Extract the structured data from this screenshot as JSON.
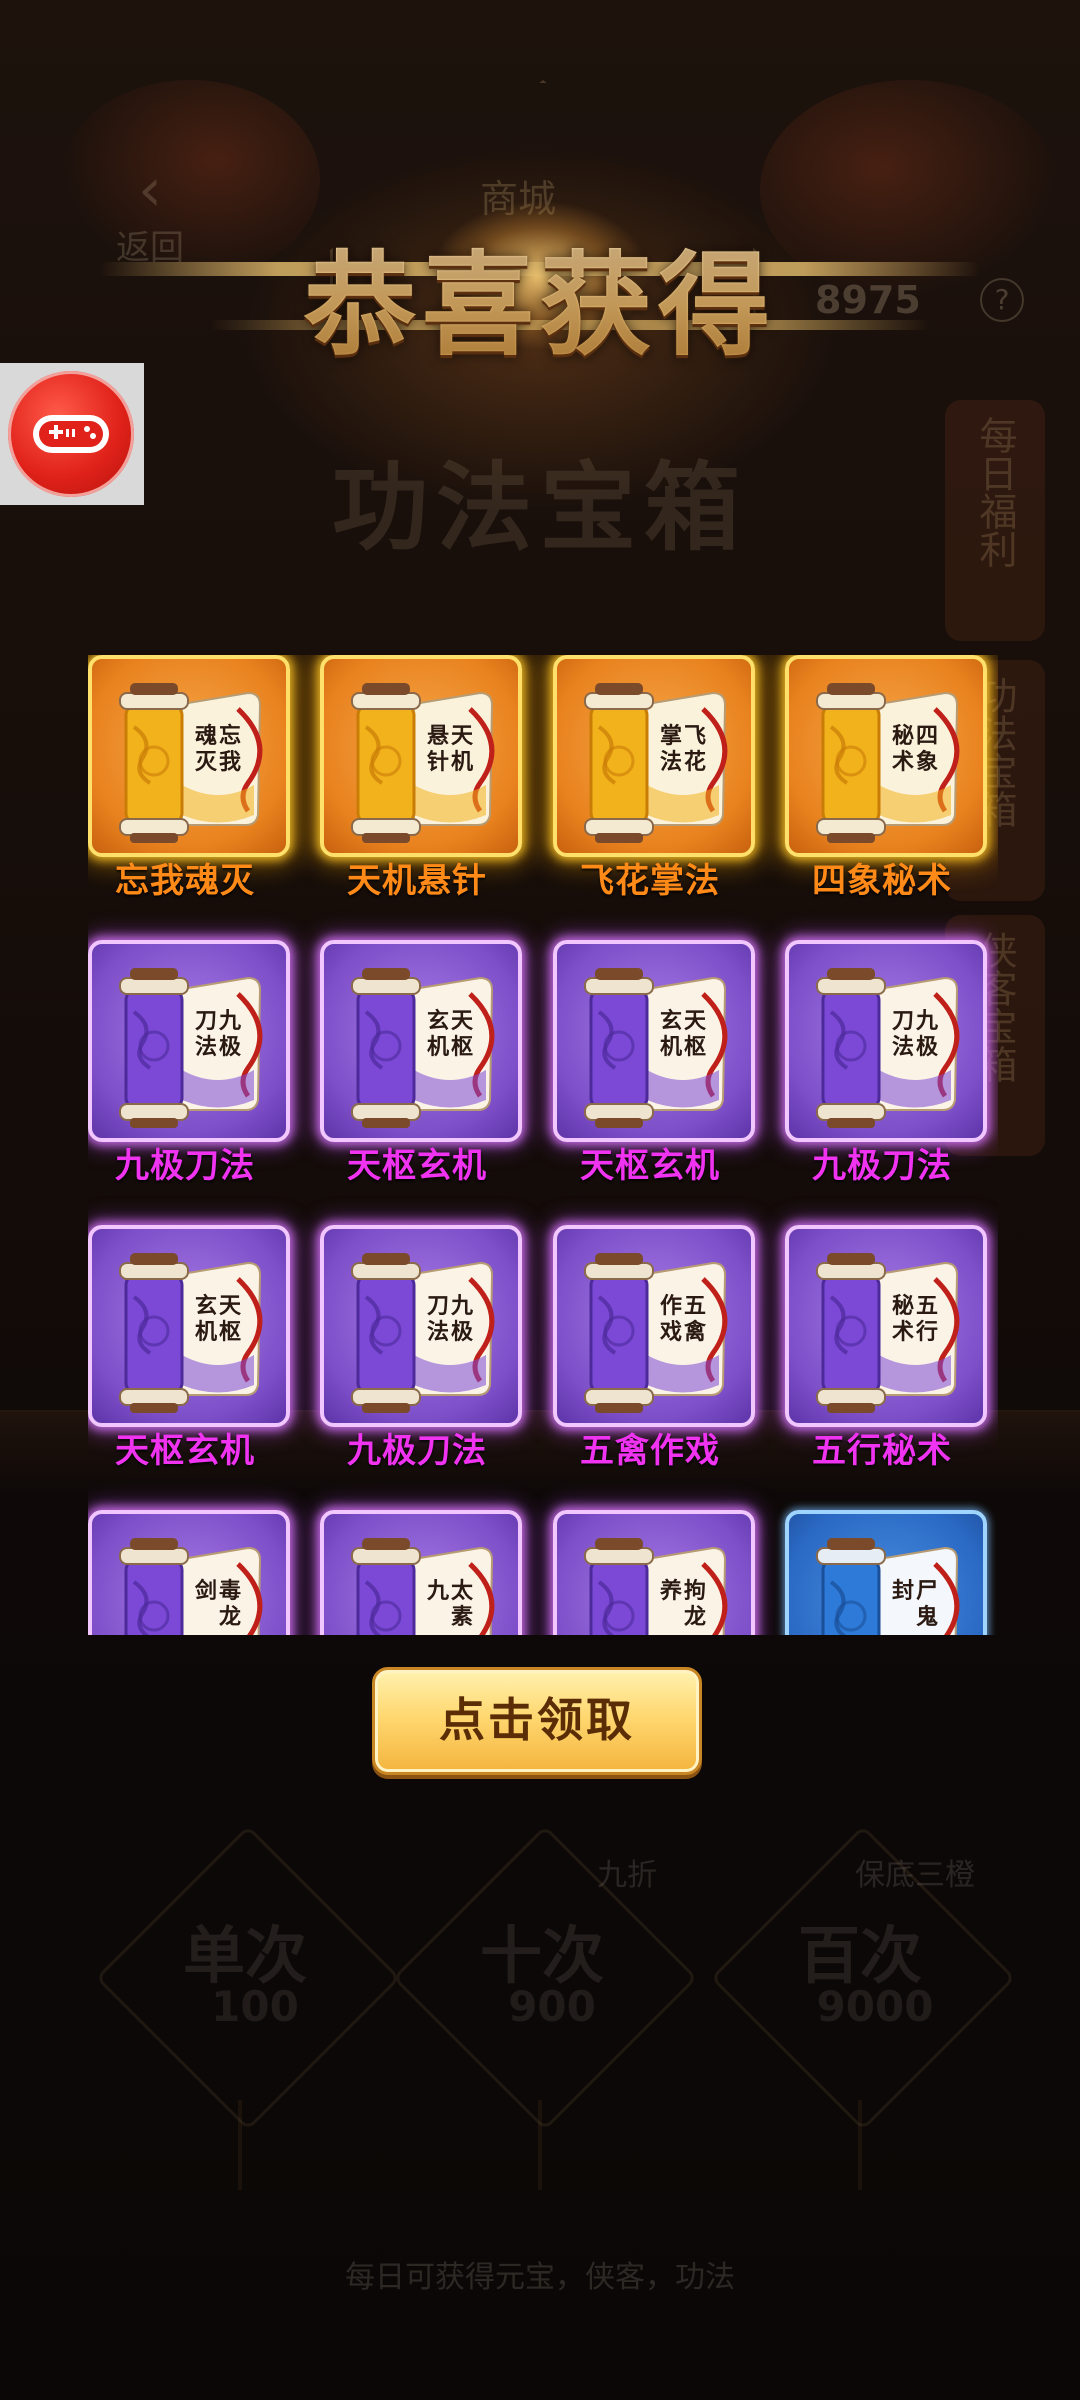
{
  "background": {
    "back_label": "返回",
    "shop_title": "商城",
    "currency_amount": "8975",
    "help_symbol": "?",
    "chest_title": "功法宝箱",
    "side_tabs": [
      "每日福利",
      "功法宝箱",
      "侠客宝箱"
    ],
    "options": [
      {
        "label": "单次",
        "price": "100",
        "tag": ""
      },
      {
        "label": "十次",
        "price": "900",
        "tag": "九折"
      },
      {
        "label": "百次",
        "price": "9000",
        "tag": "保底三橙"
      }
    ],
    "footer_note": "每日可获得元宝，侠客，功法"
  },
  "dialog": {
    "title": "恭喜获得",
    "claim_button": "点击领取"
  },
  "rewards": [
    {
      "name": "忘我魂灭",
      "scroll_text": "忘我魂灭",
      "rarity": "gold"
    },
    {
      "name": "天机悬针",
      "scroll_text": "天机悬针",
      "rarity": "gold"
    },
    {
      "name": "飞花掌法",
      "scroll_text": "飞花掌法",
      "rarity": "gold"
    },
    {
      "name": "四象秘术",
      "scroll_text": "四象秘术",
      "rarity": "gold"
    },
    {
      "name": "九极刀法",
      "scroll_text": "九极刀法",
      "rarity": "purple"
    },
    {
      "name": "天枢玄机",
      "scroll_text": "天枢玄机",
      "rarity": "purple"
    },
    {
      "name": "天枢玄机",
      "scroll_text": "天枢玄机",
      "rarity": "purple"
    },
    {
      "name": "九极刀法",
      "scroll_text": "九极刀法",
      "rarity": "purple"
    },
    {
      "name": "天枢玄机",
      "scroll_text": "天枢玄机",
      "rarity": "purple"
    },
    {
      "name": "九极刀法",
      "scroll_text": "九极刀法",
      "rarity": "purple"
    },
    {
      "name": "五禽作戏",
      "scroll_text": "五禽作戏",
      "rarity": "purple"
    },
    {
      "name": "五行秘术",
      "scroll_text": "五行秘术",
      "rarity": "purple"
    },
    {
      "name": "",
      "scroll_text": "毒龙剑",
      "rarity": "purple"
    },
    {
      "name": "",
      "scroll_text": "太素九",
      "rarity": "purple"
    },
    {
      "name": "",
      "scroll_text": "拘龙养",
      "rarity": "purple"
    },
    {
      "name": "",
      "scroll_text": "尸鬼封",
      "rarity": "blue"
    }
  ],
  "colors": {
    "gold_label": "#ff8a18",
    "purple_label": "#f033f0",
    "button_text": "#5b2d06",
    "float_button": "#e0221a"
  },
  "icons": {
    "float_button": "gamepad-icon",
    "reward": "scroll-icon",
    "back": "chevron-left-icon"
  }
}
